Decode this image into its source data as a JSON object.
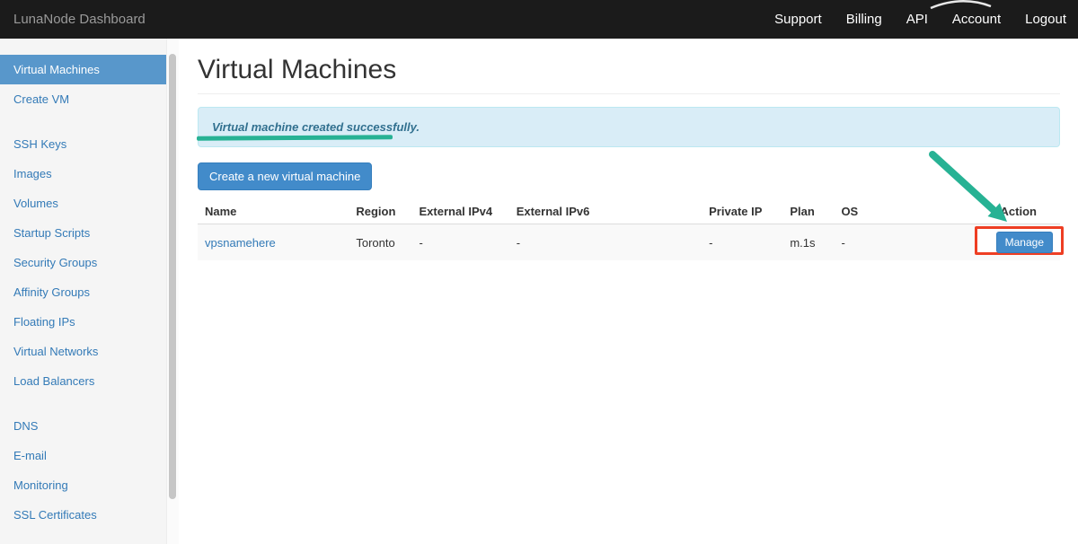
{
  "topbar": {
    "brand": "LunaNode Dashboard",
    "items": [
      {
        "label": "Support"
      },
      {
        "label": "Billing"
      },
      {
        "label": "API"
      },
      {
        "label": "Account"
      },
      {
        "label": "Logout"
      }
    ]
  },
  "sidebar": {
    "items": [
      {
        "label": "Virtual Machines",
        "active": true
      },
      {
        "label": "Create VM"
      },
      {
        "label": "SSH Keys"
      },
      {
        "label": "Images"
      },
      {
        "label": "Volumes"
      },
      {
        "label": "Startup Scripts"
      },
      {
        "label": "Security Groups"
      },
      {
        "label": "Affinity Groups"
      },
      {
        "label": "Floating IPs"
      },
      {
        "label": "Virtual Networks"
      },
      {
        "label": "Load Balancers"
      },
      {
        "label": "DNS"
      },
      {
        "label": "E-mail"
      },
      {
        "label": "Monitoring"
      },
      {
        "label": "SSL Certificates"
      }
    ]
  },
  "main": {
    "title": "Virtual Machines",
    "alert_message": "Virtual machine created successfully.",
    "create_vm_button": "Create a new virtual machine",
    "table": {
      "headers": [
        "Name",
        "Region",
        "External IPv4",
        "External IPv6",
        "Private IP",
        "Plan",
        "OS",
        "Action"
      ],
      "rows": [
        {
          "name": "vpsnamehere",
          "region": "Toronto",
          "external_ipv4": "-",
          "external_ipv6": "-",
          "private_ip": "-",
          "plan": "m.1s",
          "os": "-",
          "action_label": "Manage"
        }
      ]
    }
  },
  "colors": {
    "topbar_bg": "#1b1b1b",
    "sidebar_active_bg": "#5897cb",
    "link_blue": "#337ab7",
    "alert_bg": "#d9edf7",
    "alert_text": "#31708f",
    "primary_button_bg": "#428bca",
    "annotation_green": "#27b294",
    "annotation_red": "#ee3e23"
  }
}
